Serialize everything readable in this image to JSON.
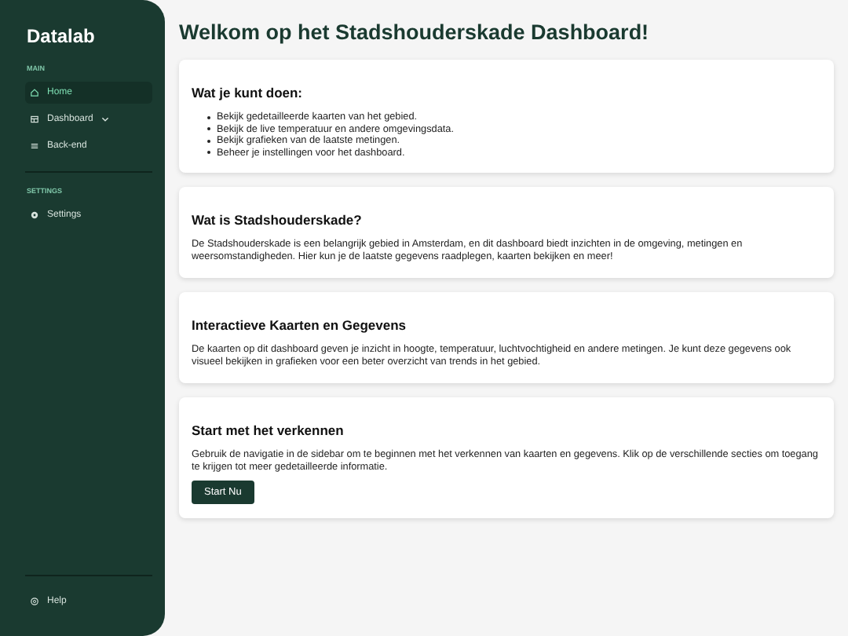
{
  "sidebar": {
    "brand": "Datalab",
    "sections": [
      {
        "label": "MAIN",
        "items": [
          {
            "label": "Home",
            "kind": "home",
            "selected": true,
            "has_caret": false
          },
          {
            "label": "Dashboard",
            "kind": "dashboard",
            "selected": false,
            "has_caret": true
          },
          {
            "label": "Back-end",
            "kind": "list",
            "selected": false,
            "has_caret": false
          }
        ]
      },
      {
        "label": "SETTINGS",
        "items": [
          {
            "label": "Settings",
            "kind": "gear",
            "selected": false,
            "has_caret": false
          }
        ]
      }
    ],
    "footer": {
      "label": "Help"
    }
  },
  "main": {
    "title": "Welkom op het Stadshouderskade Dashboard!",
    "cards": [
      {
        "heading": "Wat je kunt doen:",
        "kind": "list",
        "items": [
          "Bekijk gedetailleerde kaarten van het gebied.",
          "Bekijk de live temperatuur en andere omgevingsdata.",
          "Bekijk grafieken van de laatste metingen.",
          "Beheer je instellingen voor het dashboard."
        ]
      },
      {
        "heading": "Wat is Stadshouderskade?",
        "kind": "text",
        "text": "De Stadshouderskade is een belangrijk gebied in Amsterdam, en dit dashboard biedt inzichten in de omgeving, metingen en weersomstandigheden. Hier kun je de laatste gegevens raadplegen, kaarten bekijken en meer!"
      },
      {
        "heading": "Interactieve Kaarten en Gegevens",
        "kind": "text",
        "text": "De kaarten op dit dashboard geven je inzicht in hoogte, temperatuur, luchtvochtigheid en andere metingen. Je kunt deze gegevens ook visueel bekijken in grafieken voor een beter overzicht van trends in het gebied."
      },
      {
        "heading": "Start met het verkennen",
        "kind": "action",
        "text": "Gebruik de navigatie in de sidebar om te beginnen met het verkennen van kaarten en gegevens. Klik op de verschillende secties om toegang te krijgen tot meer gedetailleerde informatie.",
        "button": "Start Nu"
      }
    ]
  }
}
